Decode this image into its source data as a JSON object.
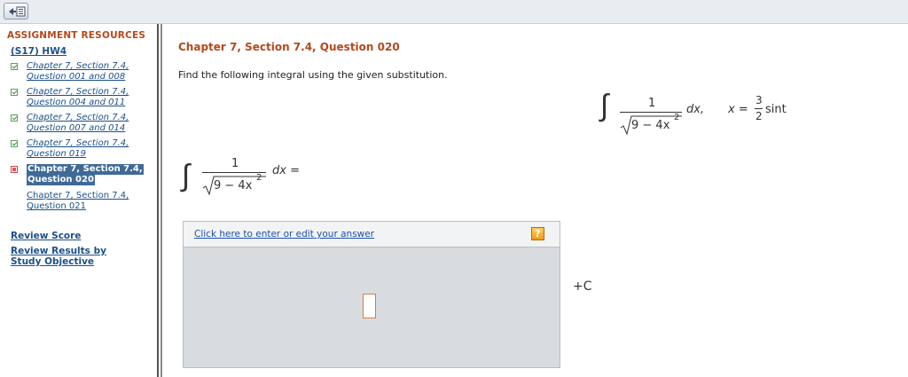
{
  "topbar": {
    "collapse_icon": "collapse-sidebar-icon"
  },
  "sidebar": {
    "title": "ASSIGNMENT RESOURCES",
    "assignment_link": "(S17) HW4",
    "questions": [
      {
        "line1": "Chapter 7, Section 7.4,",
        "line2": "Question 001 and 008",
        "status": "correct"
      },
      {
        "line1": "Chapter 7, Section 7.4,",
        "line2": "Question 004 and 011",
        "status": "correct"
      },
      {
        "line1": "Chapter 7, Section 7.4,",
        "line2": "Question 007 and 014",
        "status": "correct"
      },
      {
        "line1": "Chapter 7, Section 7.4,",
        "line2": "Question 019",
        "status": "correct"
      },
      {
        "line1": "Chapter 7, Section 7.4,",
        "line2": "Question 020",
        "status": "incorrect",
        "active": true
      },
      {
        "line1": "Chapter 7, Section 7.4,",
        "line2": "Question 021",
        "status": "none"
      }
    ],
    "review_score": "Review Score",
    "review_results_1": "Review Results by",
    "review_results_2": "Study Objective"
  },
  "question": {
    "title": "Chapter 7, Section 7.4, Question 020",
    "instruction": "Find the following integral using the given substitution.",
    "given": {
      "integral_sign": "∫",
      "numerator": "1",
      "radicand": "9 − 4x",
      "exponent": "2",
      "dx": "dx,",
      "sub_lhs": "x =",
      "frac_num": "3",
      "frac_den": "2",
      "sub_rhs": "sint"
    },
    "answer_expr": {
      "integral_sign": "∫",
      "numerator": "1",
      "radicand": "9 − 4x",
      "exponent": "2",
      "dx": "dx ="
    },
    "answer": {
      "link": "Click here to enter or edit your answer",
      "help": "?"
    },
    "plus_c": "+C"
  }
}
